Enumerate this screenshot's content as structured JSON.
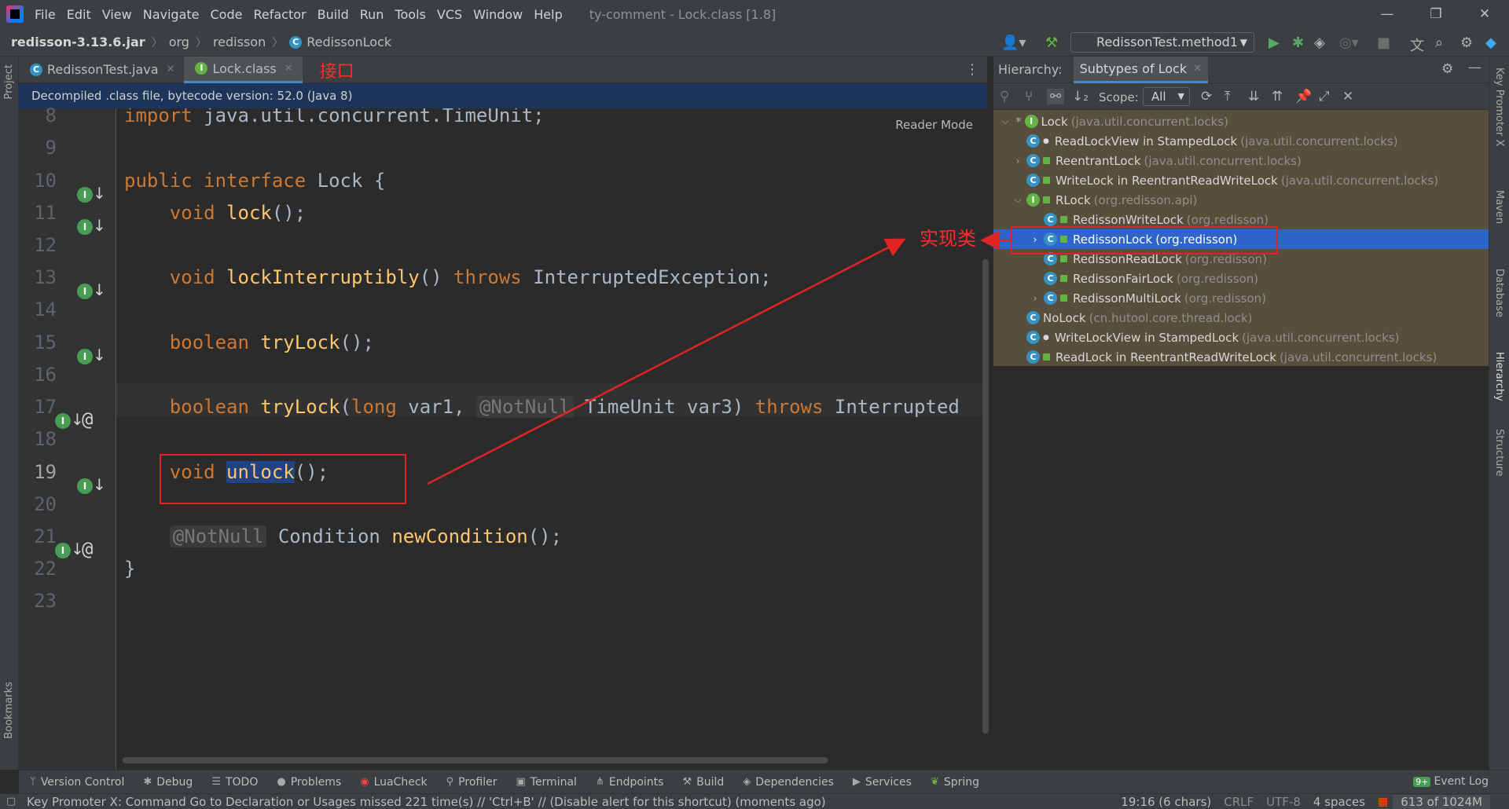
{
  "menu": {
    "items": [
      "File",
      "Edit",
      "View",
      "Navigate",
      "Code",
      "Refactor",
      "Build",
      "Run",
      "Tools",
      "VCS",
      "Window",
      "Help"
    ],
    "window_title": "ty-comment - Lock.class [1.8]"
  },
  "navbar": {
    "jar": "redisson-3.13.6.jar",
    "crumb1": "org",
    "crumb2": "redisson",
    "crumb3": "RedissonLock",
    "run_config": "RedissonTest.method1"
  },
  "editor": {
    "tabs": [
      {
        "label": "RedissonTest.java"
      },
      {
        "label": "Lock.class"
      }
    ],
    "tab_annotation": "接口",
    "banner": "Decompiled .class file, bytecode version: 52.0 (Java 8)",
    "reader_mode": "Reader Mode",
    "line_numbers": [
      "8",
      "9",
      "10",
      "11",
      "12",
      "13",
      "14",
      "15",
      "16",
      "17",
      "18",
      "19",
      "20",
      "21",
      "22",
      "23"
    ],
    "code": {
      "l8_kw": "import",
      "l8_rest": " java.util.concurrent.TimeUnit;",
      "l10_kw": "public interface",
      "l10_rest": " Lock {",
      "l11_kw": "void",
      "l11_fn": "lock",
      "l11_rest": "();",
      "l13_kw": "void",
      "l13_fn": "lockInterruptibly",
      "l13_mid": "() ",
      "l13_kw2": "throws",
      "l13_rest": " InterruptedException;",
      "l15_kw": "boolean",
      "l15_fn": "tryLock",
      "l15_rest": "();",
      "l17_kw": "boolean",
      "l17_fn": "tryLock",
      "l17_p": "(",
      "l17_kw2": "long",
      "l17_a": " var1, ",
      "l17_hint": "@NotNull",
      "l17_b": " TimeUnit var3) ",
      "l17_kw3": "throws",
      "l17_rest": " Interrupted",
      "l19_kw": "void",
      "l19_fn": "unlock",
      "l19_rest": "();",
      "l21_hint": "@NotNull",
      "l21_a": " Condition ",
      "l21_fn": "newCondition",
      "l21_rest": "();",
      "l22": "}"
    }
  },
  "hierarchy": {
    "label": "Hierarchy:",
    "tab": "Subtypes of Lock",
    "scope_label": "Scope:",
    "scope_value": "All",
    "annotation": "实现类",
    "rows": [
      {
        "name": "Lock",
        "pkg": "(java.util.concurrent.locks)"
      },
      {
        "name": "ReadLockView in StampedLock",
        "pkg": "(java.util.concurrent.locks)"
      },
      {
        "name": "ReentrantLock",
        "pkg": "(java.util.concurrent.locks)"
      },
      {
        "name": "WriteLock in ReentrantReadWriteLock",
        "pkg": "(java.util.concurrent.locks)"
      },
      {
        "name": "RLock",
        "pkg": "(org.redisson.api)"
      },
      {
        "name": "RedissonWriteLock",
        "pkg": "(org.redisson)"
      },
      {
        "name": "RedissonLock",
        "pkg": "(org.redisson)"
      },
      {
        "name": "RedissonReadLock",
        "pkg": "(org.redisson)"
      },
      {
        "name": "RedissonFairLock",
        "pkg": "(org.redisson)"
      },
      {
        "name": "RedissonMultiLock",
        "pkg": "(org.redisson)"
      },
      {
        "name": "NoLock",
        "pkg": "(cn.hutool.core.thread.lock)"
      },
      {
        "name": "WriteLockView in StampedLock",
        "pkg": "(java.util.concurrent.locks)"
      },
      {
        "name": "ReadLock in ReentrantReadWriteLock",
        "pkg": "(java.util.concurrent.locks)"
      }
    ]
  },
  "side": {
    "project": "Project",
    "bookmarks": "Bookmarks",
    "key_promoter": "Key Promoter X",
    "maven": "Maven",
    "database": "Database",
    "hierarchy": "Hierarchy",
    "structure": "Structure"
  },
  "toolwindows": [
    "Version Control",
    "Debug",
    "TODO",
    "Problems",
    "LuaCheck",
    "Profiler",
    "Terminal",
    "Endpoints",
    "Build",
    "Dependencies",
    "Services",
    "Spring"
  ],
  "event_log": {
    "badge": "9+",
    "label": "Event Log"
  },
  "status": {
    "message": "Key Promoter X: Command Go to Declaration or Usages missed 221 time(s) // 'Ctrl+B' // (Disable alert for this shortcut) (moments ago)",
    "position": "19:16 (6 chars)",
    "line_sep": "CRLF",
    "encoding": "UTF-8",
    "indent": "4 spaces",
    "memory": "613 of 1024M"
  },
  "colors": {
    "annotation_red": "#e02424",
    "selection_blue": "#2f65ca",
    "keyword": "#cc7832",
    "function": "#ffc66d"
  }
}
